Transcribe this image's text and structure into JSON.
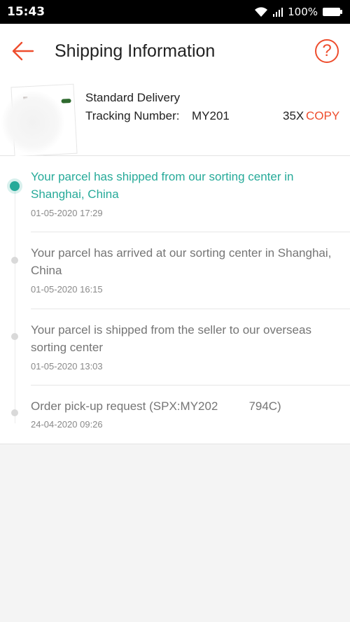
{
  "status_bar": {
    "time": "15:43",
    "battery": "100%"
  },
  "header": {
    "title": "Shipping Information",
    "help_glyph": "?"
  },
  "delivery": {
    "type": "Standard Delivery",
    "tracking_label": "Tracking Number:",
    "tracking_number_prefix": "MY201",
    "tracking_number_suffix": "35X",
    "copy_label": "COPY"
  },
  "timeline": [
    {
      "text": "Your parcel has shipped from our sorting center in Shanghai, China",
      "time": "01-05-2020 17:29",
      "active": true
    },
    {
      "text": "Your parcel has arrived at our sorting center in Shanghai, China",
      "time": "01-05-2020 16:15",
      "active": false
    },
    {
      "text": "Your parcel is shipped from the seller to our overseas sorting center",
      "time": "01-05-2020 13:03",
      "active": false
    },
    {
      "text_prefix": "Order pick-up request (SPX:MY202",
      "text_suffix": "794C)",
      "time": "24-04-2020 09:26",
      "active": false
    }
  ],
  "colors": {
    "accent": "#ee4d2d",
    "active_status": "#26aa99"
  },
  "icons": {
    "back": "arrow-left-icon",
    "help": "question-circle-icon",
    "wifi": "wifi-icon",
    "signal": "signal-icon",
    "battery": "battery-icon"
  }
}
